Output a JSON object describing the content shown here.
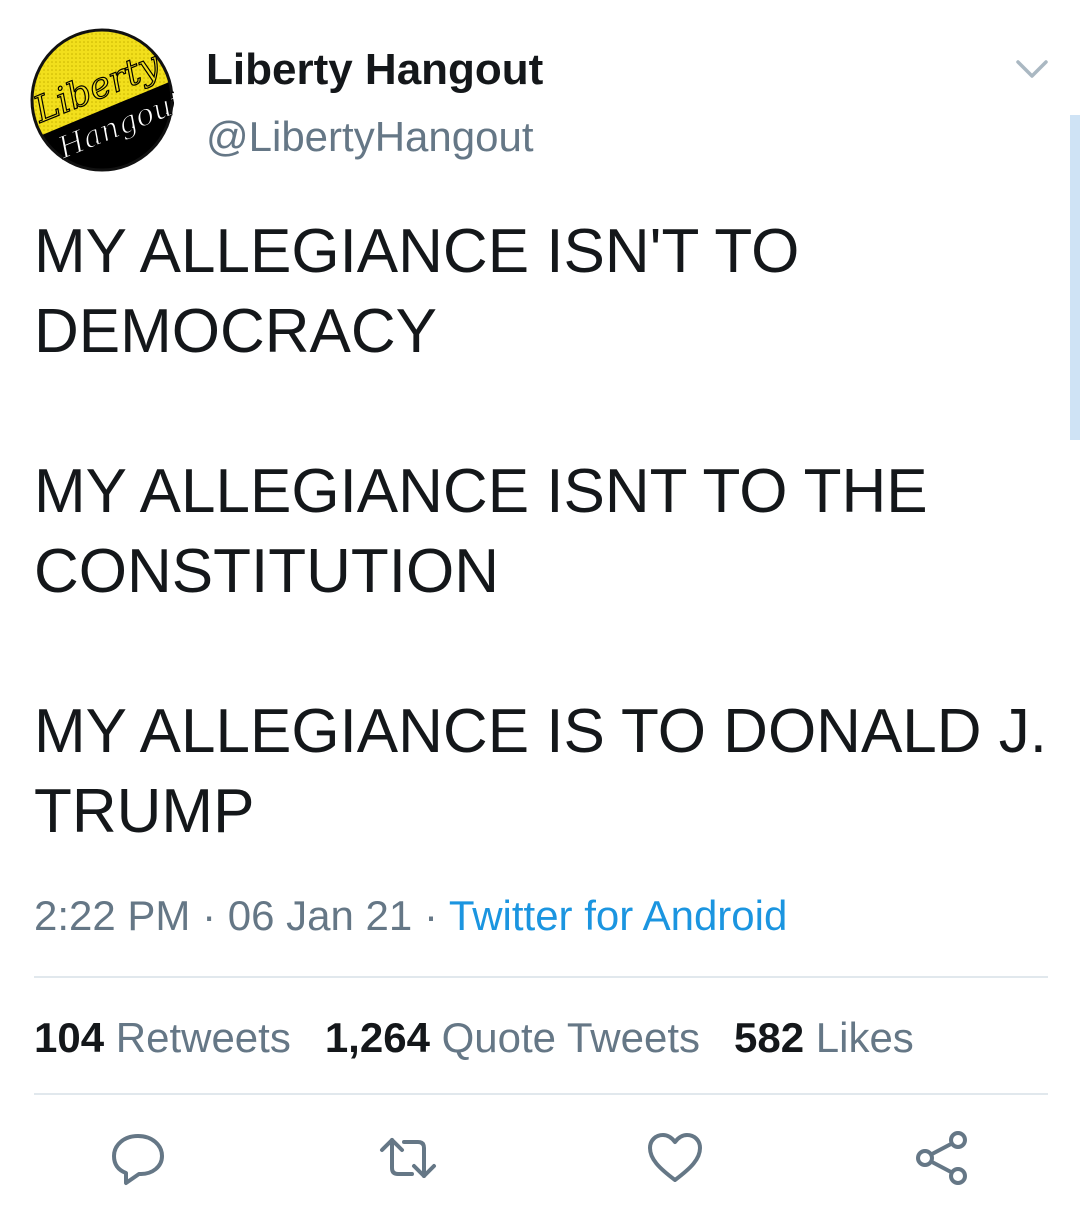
{
  "header": {
    "avatar_text_line1": "Liberty",
    "avatar_text_line2": "Hangout",
    "display_name": "Liberty Hangout",
    "handle": "@LibertyHangout",
    "menu_icon": "chevron-down-icon"
  },
  "tweet": {
    "text": "MY ALLEGIANCE ISN'T TO\nDEMOCRACY\n\nMY ALLEGIANCE ISNT TO THE\nCONSTITUTION\n\nMY ALLEGIANCE IS TO DONALD J.\nTRUMP",
    "time": "2:22 PM",
    "date": "06 Jan 21",
    "separator": "·",
    "source": "Twitter for Android"
  },
  "stats": {
    "retweets_count": "104",
    "retweets_label": "Retweets",
    "quote_count": "1,264",
    "quote_label": "Quote Tweets",
    "likes_count": "582",
    "likes_label": "Likes"
  },
  "actions": {
    "reply_icon": "reply-icon",
    "retweet_icon": "retweet-icon",
    "like_icon": "heart-icon",
    "share_icon": "share-icon"
  },
  "colors": {
    "text": "#14171a",
    "secondary": "#657786",
    "link": "#1b95e0",
    "avatar_yellow": "#f2df1c",
    "avatar_black": "#000000"
  }
}
